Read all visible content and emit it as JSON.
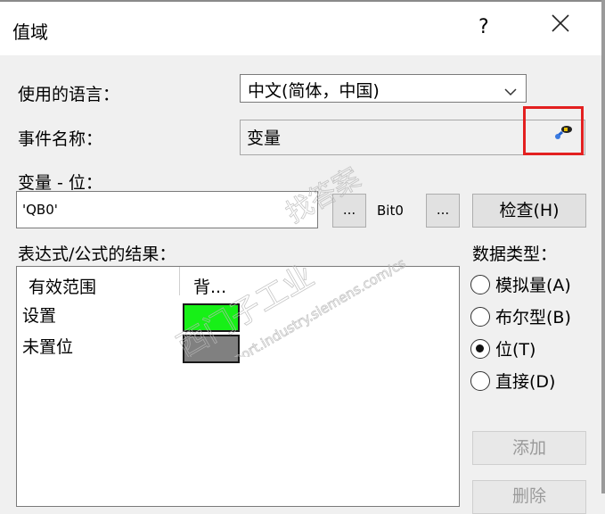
{
  "window": {
    "title": "值域",
    "help_glyph": "?",
    "close_glyph": "╳"
  },
  "language": {
    "label": "使用的语言：",
    "selected": "中文(简体，中国)"
  },
  "event": {
    "label": "事件名称：",
    "value": "变量",
    "icon": "event-select-icon"
  },
  "variable": {
    "label": "变量 - 位：",
    "value": "'QB0'",
    "browse_label": "...",
    "bit_label": "Bit0",
    "bit_browse_label": "...",
    "check_label": "检查(H)"
  },
  "results": {
    "label": "表达式/公式的结果：",
    "columns": [
      "有效范围",
      "背..."
    ],
    "rows": [
      {
        "label": "设置",
        "color": "#17f017"
      },
      {
        "label": "未置位",
        "color": "#808080"
      }
    ]
  },
  "data_type": {
    "label": "数据类型：",
    "options": [
      {
        "label": "模拟量(A)",
        "selected": false
      },
      {
        "label": "布尔型(B)",
        "selected": false
      },
      {
        "label": "位(T)",
        "selected": true
      },
      {
        "label": "直接(D)",
        "selected": false
      }
    ]
  },
  "actions": {
    "add_label": "添加",
    "delete_label": "删除"
  },
  "watermark": {
    "line1": "西门子工业",
    "line2": "找答案",
    "line3": "support.industry.siemens.com/cs"
  },
  "colors": {
    "highlight_border": "#e32020",
    "set_color": "#17f017",
    "unset_color": "#808080"
  }
}
